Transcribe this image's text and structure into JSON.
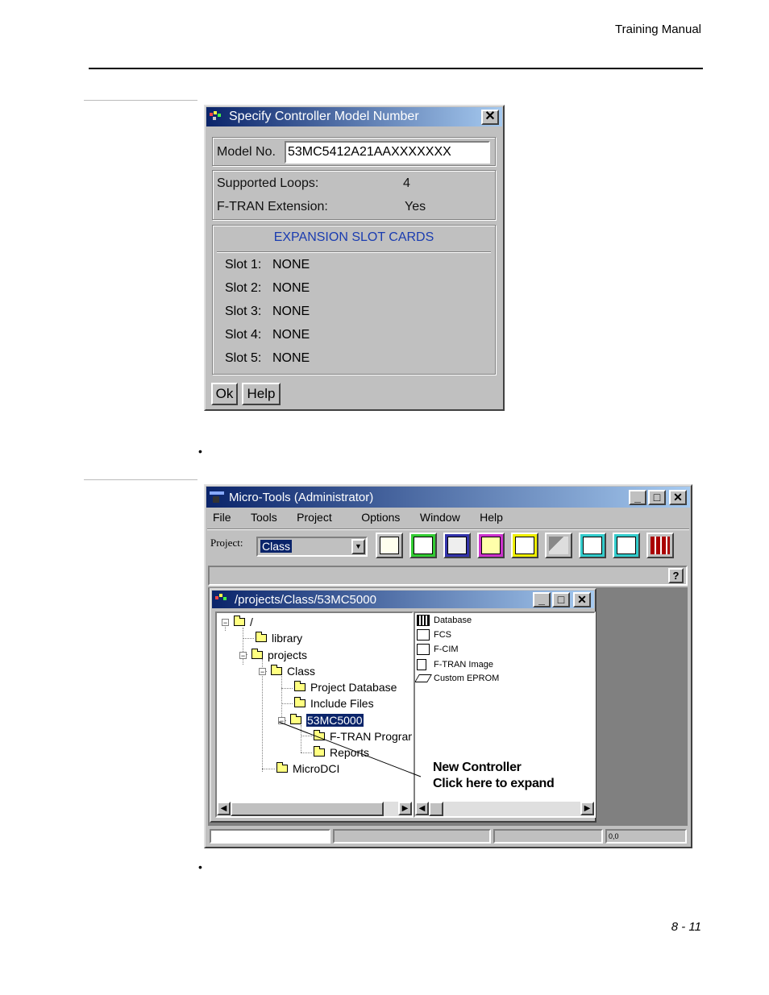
{
  "header": {
    "title": "Training Manual"
  },
  "page_number": "8 - 11",
  "bullets": [
    "•",
    "•"
  ],
  "dialog1": {
    "title": "Specify Controller Model Number",
    "close_glyph": "✕",
    "model_label": "Model No.",
    "model_value": "53MC5412A21AAXXXXXXX",
    "supported_loops_label": "Supported Loops:",
    "supported_loops_value": "4",
    "ftran_label": "F-TRAN Extension:",
    "ftran_value": "Yes",
    "expansion_heading": "EXPANSION SLOT CARDS",
    "slots": [
      {
        "label": "Slot 1:",
        "value": "NONE"
      },
      {
        "label": "Slot 2:",
        "value": "NONE"
      },
      {
        "label": "Slot 3:",
        "value": "NONE"
      },
      {
        "label": "Slot 4:",
        "value": "NONE"
      },
      {
        "label": "Slot 5:",
        "value": "NONE"
      }
    ],
    "ok_label": "Ok",
    "help_label": "Help"
  },
  "microtools": {
    "title": "Micro-Tools (Administrator)",
    "window_buttons": [
      "_",
      "□",
      "✕"
    ],
    "menu": [
      "File",
      "Tools",
      "Project",
      "Options",
      "Window",
      "Help"
    ],
    "project_label": "Project:",
    "project_value": "Class",
    "help_glyph": "?",
    "tool_icons": [
      "tree-tool-icon",
      "database-tool-icon",
      "fcs-tool-icon",
      "fcim-tool-icon",
      "ftran-tool-icon",
      "build-tool-icon",
      "download-tool-icon",
      "upload-tool-icon",
      "controller-tool-icon"
    ],
    "status_coord": "0,0",
    "child": {
      "title": "/projects/Class/53MC5000",
      "tree": [
        {
          "label": "/",
          "level": 0,
          "expander": "−"
        },
        {
          "label": "library",
          "level": 1
        },
        {
          "label": "projects",
          "level": 1,
          "expander": "−"
        },
        {
          "label": "Class",
          "level": 2,
          "expander": "−"
        },
        {
          "label": "Project Database",
          "level": 3
        },
        {
          "label": "Include Files",
          "level": 3
        },
        {
          "label": "53MC5000",
          "level": 3,
          "expander": "−",
          "selected": true
        },
        {
          "label": "F-TRAN Program",
          "level": 4
        },
        {
          "label": "Reports",
          "level": 4
        },
        {
          "label": "MicroDCI",
          "level": 2
        }
      ],
      "files": [
        "Database",
        "FCS",
        "F-CIM",
        "F-TRAN Image",
        "Custom EPROM"
      ],
      "annotation_line1": "New Controller",
      "annotation_line2": "Click here to expand"
    }
  }
}
